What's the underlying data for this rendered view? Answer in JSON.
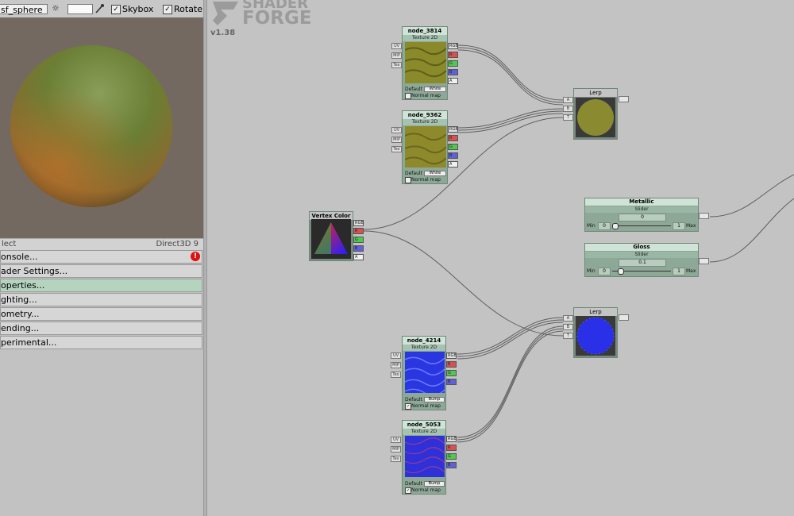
{
  "toolbar": {
    "mesh_name": "sf_sphere",
    "light_symbol": "☼",
    "skybox_label": "Skybox",
    "skybox_checked": "✓",
    "rotate_label": "Rotate",
    "rotate_checked": "✓"
  },
  "preview_status": {
    "left": "lect",
    "right": "Direct3D 9"
  },
  "menu": [
    {
      "label": "onsole...",
      "badge": "!"
    },
    {
      "label": "ader Settings..."
    },
    {
      "label": "operties..."
    },
    {
      "label": "ghting..."
    },
    {
      "label": "ometry..."
    },
    {
      "label": "ending..."
    },
    {
      "label": "perimental..."
    }
  ],
  "logo": {
    "line1": "SHADER",
    "line2": "FORGE",
    "version": "v1.38"
  },
  "colors": {
    "node_body": "#8ea898",
    "node_title": "#cfe3d6",
    "active_menu": "#b4d4c0",
    "canvas": "#c3c3c3"
  },
  "nodes": {
    "node_3814": {
      "title": "node_3814",
      "type": "Texture 2D",
      "inputs": [
        "UV",
        "MIP",
        "Tex"
      ],
      "outputs": [
        "RGB",
        "R",
        "G",
        "B",
        "A"
      ],
      "default_label": "Default",
      "default_value": "White",
      "normal_label": "Normal map",
      "normal_checked": ""
    },
    "node_9362": {
      "title": "node_9362",
      "type": "Texture 2D",
      "inputs": [
        "UV",
        "MIP",
        "Tex"
      ],
      "outputs": [
        "RGB",
        "R",
        "G",
        "B",
        "A"
      ],
      "default_label": "Default",
      "default_value": "White",
      "normal_label": "Normal map",
      "normal_checked": ""
    },
    "node_4214": {
      "title": "node_4214",
      "type": "Texture 2D",
      "inputs": [
        "UV",
        "MIP",
        "Tex"
      ],
      "outputs": [
        "RGB",
        "R",
        "G",
        "B",
        "A"
      ],
      "default_label": "Default",
      "default_value": "Bump",
      "normal_label": "Normal map",
      "normal_checked": "✓"
    },
    "node_5053": {
      "title": "node_5053",
      "type": "Texture 2D",
      "inputs": [
        "UV",
        "MIP",
        "Tex"
      ],
      "outputs": [
        "RGB",
        "R",
        "G",
        "B",
        "A"
      ],
      "default_label": "Default",
      "default_value": "Bump",
      "normal_label": "Normal map",
      "normal_checked": "✓"
    },
    "lerp1": {
      "title": "Lerp",
      "inputs": [
        "A",
        "B",
        "T"
      ]
    },
    "lerp2": {
      "title": "Lerp",
      "inputs": [
        "A",
        "B",
        "T"
      ]
    },
    "vertex_color": {
      "title": "Vertex Color",
      "outputs": [
        "RGB",
        "R",
        "G",
        "B",
        "A"
      ]
    },
    "metallic": {
      "title": "Metallic",
      "type": "Slider",
      "value": "0",
      "min_label": "Min",
      "min": "0",
      "max": "1",
      "max_label": "Max",
      "level": 0.0
    },
    "gloss": {
      "title": "Gloss",
      "type": "Slider",
      "value": "0.1",
      "min_label": "Min",
      "min": "0",
      "max": "1",
      "max_label": "Max",
      "level": 0.1
    }
  }
}
